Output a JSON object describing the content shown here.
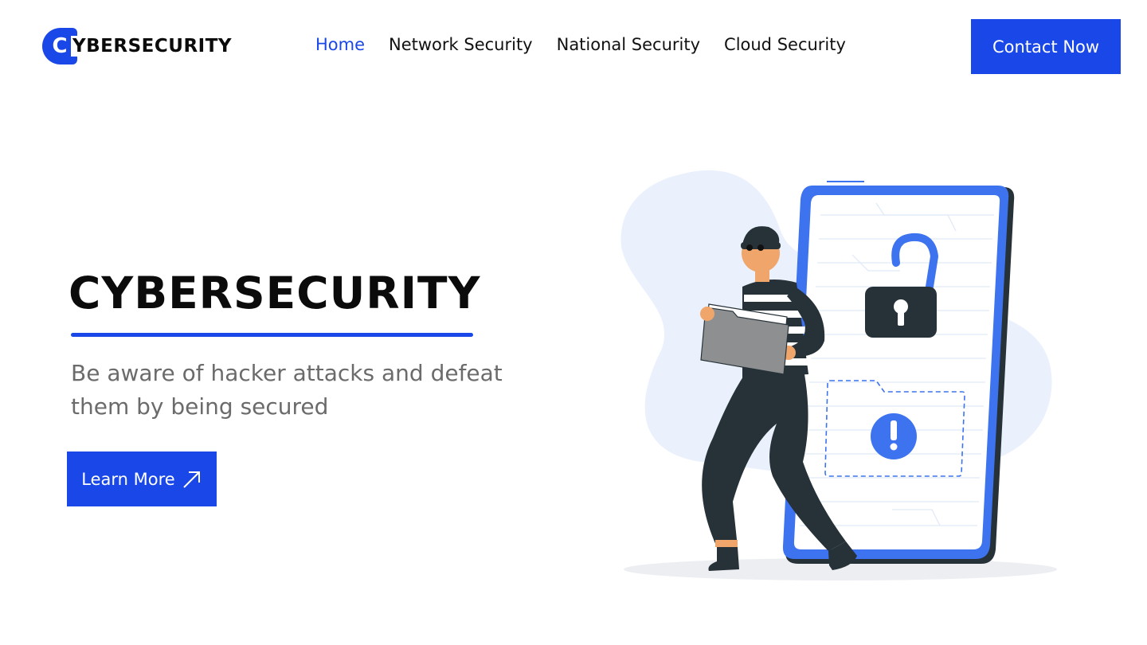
{
  "header": {
    "logo_letter": "C",
    "logo_text": "YBERSECURITY",
    "nav": [
      {
        "label": "Home",
        "active": true
      },
      {
        "label": "Network Security",
        "active": false
      },
      {
        "label": "National Security",
        "active": false
      },
      {
        "label": "Cloud Security",
        "active": false
      }
    ],
    "contact_label": "Contact Now"
  },
  "hero": {
    "title": "CYBERSECURITY",
    "subtitle": "Be aware of hacker attacks and defeat them by being secured",
    "cta_label": "Learn More"
  },
  "colors": {
    "accent": "#1a47e8",
    "text_muted": "#6b6b6b",
    "illustration_blue": "#3d73ef",
    "illustration_dark": "#263238"
  },
  "icons": {
    "cta_icon": "arrow-up-right-icon",
    "illustration": "hacker-phone-illustration"
  }
}
